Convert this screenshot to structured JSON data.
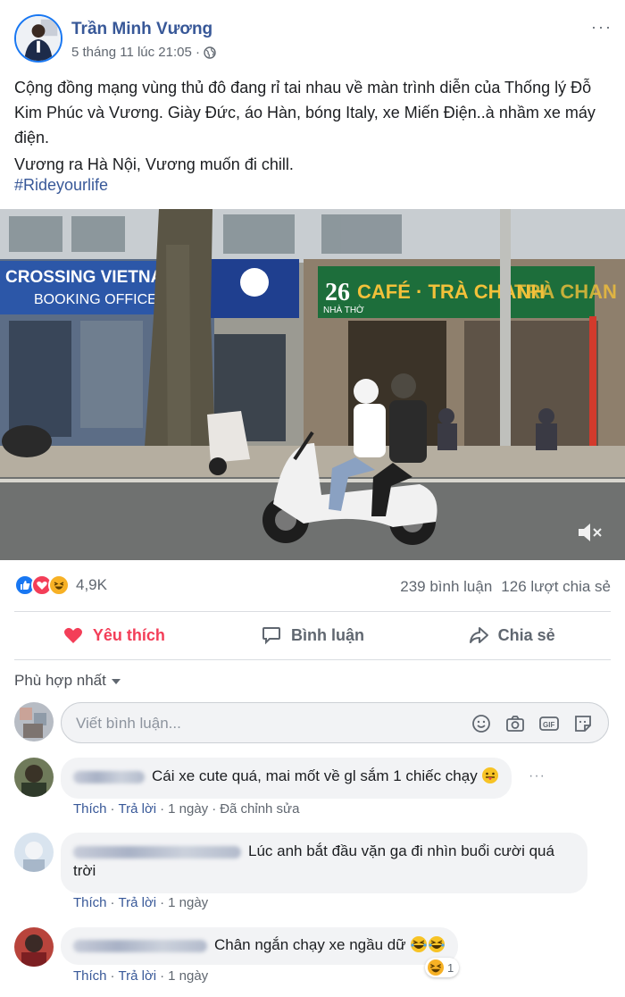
{
  "post": {
    "author": "Trần Minh Vương",
    "timestamp": "5 tháng 11 lúc 21:05 ·",
    "privacy_icon": "globe-icon",
    "more_label": "···",
    "text_paragraph_1": "Cộng đồng mạng vùng thủ đô đang rỉ tai nhau về màn trình diễn của Thống lý Đỗ Kim Phúc và Vương. Giày Đức, áo Hàn, bóng Italy, xe Miến Điện..à nhầm xe máy điện.",
    "text_paragraph_2": "Vương ra Hà Nội, Vương muốn đi chill.",
    "hashtag": "#Rideyourlife"
  },
  "video": {
    "signs": {
      "crossing": "CROSSING VIETNAM T",
      "booking": "BOOKING OFFICE",
      "number": "26",
      "cafe": "CAFÉ · TRÀ CHANH",
      "cafe_right": "TRÀ CHAN",
      "nha_tho": "NHÀ THỜ"
    },
    "mute_icon": "muted-speaker-icon"
  },
  "stats": {
    "reaction_count": "4,9K",
    "comments": "239 bình luận",
    "shares": "126 lượt chia sẻ"
  },
  "actions": {
    "like": "Yêu thích",
    "comment": "Bình luận",
    "share": "Chia sẻ"
  },
  "sort_label": "Phù hợp nhất",
  "composer": {
    "placeholder": "Viết bình luận..."
  },
  "comments": [
    {
      "text": "Cái xe cute quá, mai mốt về gl sắm 1 chiếc chạy",
      "like": "Thích",
      "reply": "Trả lời",
      "time": "1 ngày",
      "edited": "Đã chỉnh sửa"
    },
    {
      "text": "Lúc anh bắt đầu vặn ga đi nhìn buổi cười quá trời",
      "like": "Thích",
      "reply": "Trả lời",
      "time": "1 ngày"
    },
    {
      "text": "Chân ngắn chạy xe ngầu dữ",
      "like": "Thích",
      "reply": "Trả lời",
      "time": "1 ngày",
      "reaction_count": "1"
    }
  ],
  "colors": {
    "link": "#385898",
    "like_active": "#f33e58",
    "secondary": "#606770",
    "bubble": "#f2f3f5"
  }
}
